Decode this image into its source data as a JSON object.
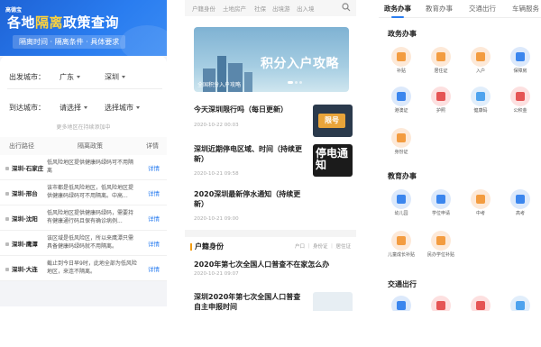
{
  "panel1": {
    "logo": "高德宝",
    "title_part1": "各地",
    "title_highlight": "隔离",
    "title_part2": "政策查询",
    "subtitle": "隔离时间 · 隔离条件 · 具体要求",
    "departure": {
      "label": "出发城市：",
      "province": "广东",
      "city": "深圳"
    },
    "arrival": {
      "label": "到达城市：",
      "province": "请选择",
      "city": "选择城市"
    },
    "note": "更多地区在持续添加中",
    "columns": [
      "出行路径",
      "隔离政策",
      "详情"
    ],
    "rows": [
      {
        "route": "深圳-石家庄",
        "policy": "低风险地区提供健康码绿码可不用隔离",
        "link": "详情"
      },
      {
        "route": "深圳-邢台",
        "policy": "该市都是低风险地区，低风险地区提供健康码绿码可不用隔离。中高...",
        "link": "详情"
      },
      {
        "route": "深圳-沈阳",
        "policy": "低风险地区提供健康码绿码，需要持有健康通行码且保有确诊病例...",
        "link": "详情"
      },
      {
        "route": "深圳-鹰潭",
        "policy": "该区域是低风险区，所以来鹰潭只需具备健康码绿码就不用隔离。",
        "link": "详情"
      },
      {
        "route": "深圳-大连",
        "policy": "截止到今日早9时，此地全部为低风险地区，来连不隔离。",
        "link": "详情"
      }
    ]
  },
  "panel2": {
    "nav": [
      "户籍身份",
      "土地房产",
      "社保",
      "出境游",
      "出入境"
    ],
    "banner": {
      "title": "积分入户攻略",
      "caption": "全国积分入户攻略"
    },
    "news": [
      {
        "title": "今天深圳限行吗（每日更新）",
        "date": "2020-10-22 00:03",
        "thumb_text": "限号"
      },
      {
        "title": "深圳近期停电区域、时间（持续更新）",
        "date": "2020-10-21 09:58",
        "thumb_text": "停电通知"
      },
      {
        "title": "2020深圳最新停水通知（持续更新）",
        "date": "2020-10-21 09:00",
        "thumb_text": ""
      }
    ],
    "section": {
      "title": "户籍身份",
      "tabs": "户口 ｜ 身份证 ｜ 居住证"
    },
    "section_news": [
      {
        "title": "2020年第七次全国人口普查不在家怎么办",
        "date": "2020-10-21 09:07"
      },
      {
        "title": "深圳2020年第七次全国人口普查自主申报时间",
        "date": ""
      }
    ]
  },
  "panel3": {
    "tabs": [
      "政务办事",
      "教育办事",
      "交通出行",
      "车辆服务"
    ],
    "section1": {
      "title": "政务办事",
      "items": [
        {
          "label": "补贴",
          "color": "orange"
        },
        {
          "label": "居住证",
          "color": "orange"
        },
        {
          "label": "入户",
          "color": "orange"
        },
        {
          "label": "保障房",
          "color": "blue"
        },
        {
          "label": "港澳证",
          "color": "blue"
        },
        {
          "label": "护照",
          "color": "red"
        },
        {
          "label": "健康码",
          "color": "lblue"
        },
        {
          "label": "公积金",
          "color": "red"
        },
        {
          "label": "身份证",
          "color": "orange"
        }
      ]
    },
    "section2": {
      "title": "教育办事",
      "items": [
        {
          "label": "幼儿园",
          "color": "blue"
        },
        {
          "label": "学位申请",
          "color": "blue"
        },
        {
          "label": "中考",
          "color": "orange"
        },
        {
          "label": "高考",
          "color": "blue"
        },
        {
          "label": "儿童成长补贴",
          "color": "orange"
        },
        {
          "label": "民办学位补贴",
          "color": "orange"
        }
      ]
    },
    "section3": {
      "title": "交通出行"
    }
  }
}
